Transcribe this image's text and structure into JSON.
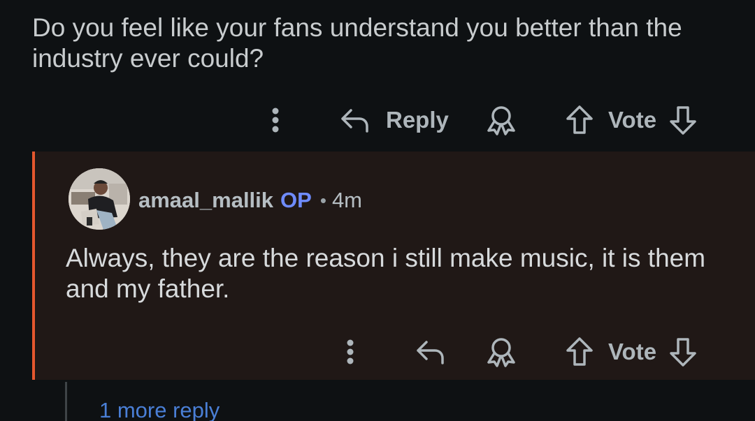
{
  "parent_comment": {
    "text": "Do you feel like your fans understand you better than the industry ever could?",
    "actions": {
      "more_icon": "more-vertical-icon",
      "reply_icon": "reply-arrow-icon",
      "reply_label": "Reply",
      "award_icon": "award-icon",
      "upvote_icon": "upvote-arrow-icon",
      "vote_label": "Vote",
      "downvote_icon": "downvote-arrow-icon"
    }
  },
  "reply_comment": {
    "username": "amaal_mallik",
    "op_badge": "OP",
    "separator": "•",
    "time": "4m",
    "avatar_icon": "user-avatar",
    "text": "Always, they are the reason i still make music, it is them and my father.",
    "accent_color": "#e4572e",
    "op_color": "#6f8cff",
    "actions": {
      "more_icon": "more-vertical-icon",
      "reply_icon": "reply-arrow-icon",
      "award_icon": "award-icon",
      "upvote_icon": "upvote-arrow-icon",
      "vote_label": "Vote",
      "downvote_icon": "downvote-arrow-icon"
    }
  },
  "more_replies": {
    "label": "1 more reply",
    "color": "#4a7fd6"
  }
}
